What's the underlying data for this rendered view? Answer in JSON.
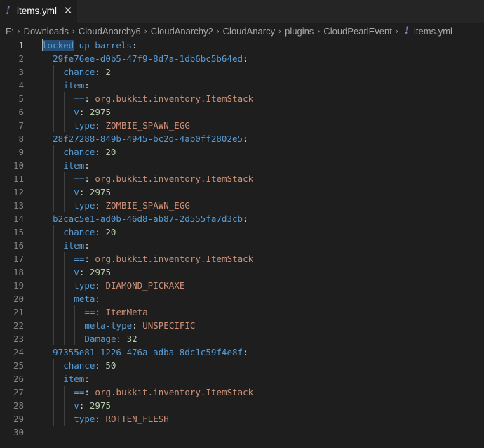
{
  "tab": {
    "icon": "!",
    "title": "items.yml",
    "close": "✕"
  },
  "breadcrumbs": {
    "items": [
      "F:",
      "Downloads",
      "CloudAnarchy6",
      "CloudAnarchy2",
      "CloudAnarcy",
      "plugins",
      "CloudPearlEvent"
    ],
    "separator": "›",
    "file_icon": "!",
    "file": "items.yml"
  },
  "editor": {
    "active_line": 1,
    "lines": [
      {
        "num": "1",
        "indent": 0,
        "key": "locked-up-barrels",
        "sep": ":",
        "value": "",
        "vtype": "",
        "highlight": "locked"
      },
      {
        "num": "2",
        "indent": 1,
        "key": "29fe76ee-d0b5-47f9-8d7a-1db6bc5b64ed",
        "sep": ":",
        "value": "",
        "vtype": ""
      },
      {
        "num": "3",
        "indent": 2,
        "key": "chance",
        "sep": ": ",
        "value": "2",
        "vtype": "n"
      },
      {
        "num": "4",
        "indent": 2,
        "key": "item",
        "sep": ":",
        "value": "",
        "vtype": ""
      },
      {
        "num": "5",
        "indent": 3,
        "key": "==",
        "sep": ": ",
        "value": "org.bukkit.inventory.ItemStack",
        "vtype": "s"
      },
      {
        "num": "6",
        "indent": 3,
        "key": "v",
        "sep": ": ",
        "value": "2975",
        "vtype": "n"
      },
      {
        "num": "7",
        "indent": 3,
        "key": "type",
        "sep": ": ",
        "value": "ZOMBIE_SPAWN_EGG",
        "vtype": "s"
      },
      {
        "num": "8",
        "indent": 1,
        "key": "28f27288-849b-4945-bc2d-4ab0ff2802e5",
        "sep": ":",
        "value": "",
        "vtype": ""
      },
      {
        "num": "9",
        "indent": 2,
        "key": "chance",
        "sep": ": ",
        "value": "20",
        "vtype": "n"
      },
      {
        "num": "10",
        "indent": 2,
        "key": "item",
        "sep": ":",
        "value": "",
        "vtype": ""
      },
      {
        "num": "11",
        "indent": 3,
        "key": "==",
        "sep": ": ",
        "value": "org.bukkit.inventory.ItemStack",
        "vtype": "s"
      },
      {
        "num": "12",
        "indent": 3,
        "key": "v",
        "sep": ": ",
        "value": "2975",
        "vtype": "n"
      },
      {
        "num": "13",
        "indent": 3,
        "key": "type",
        "sep": ": ",
        "value": "ZOMBIE_SPAWN_EGG",
        "vtype": "s"
      },
      {
        "num": "14",
        "indent": 1,
        "key": "b2cac5e1-ad0b-46d8-ab87-2d555fa7d3cb",
        "sep": ":",
        "value": "",
        "vtype": ""
      },
      {
        "num": "15",
        "indent": 2,
        "key": "chance",
        "sep": ": ",
        "value": "20",
        "vtype": "n"
      },
      {
        "num": "16",
        "indent": 2,
        "key": "item",
        "sep": ":",
        "value": "",
        "vtype": ""
      },
      {
        "num": "17",
        "indent": 3,
        "key": "==",
        "sep": ": ",
        "value": "org.bukkit.inventory.ItemStack",
        "vtype": "s"
      },
      {
        "num": "18",
        "indent": 3,
        "key": "v",
        "sep": ": ",
        "value": "2975",
        "vtype": "n"
      },
      {
        "num": "19",
        "indent": 3,
        "key": "type",
        "sep": ": ",
        "value": "DIAMOND_PICKAXE",
        "vtype": "s"
      },
      {
        "num": "20",
        "indent": 3,
        "key": "meta",
        "sep": ":",
        "value": "",
        "vtype": ""
      },
      {
        "num": "21",
        "indent": 4,
        "key": "==",
        "sep": ": ",
        "value": "ItemMeta",
        "vtype": "s"
      },
      {
        "num": "22",
        "indent": 4,
        "key": "meta-type",
        "sep": ": ",
        "value": "UNSPECIFIC",
        "vtype": "s"
      },
      {
        "num": "23",
        "indent": 4,
        "key": "Damage",
        "sep": ": ",
        "value": "32",
        "vtype": "n"
      },
      {
        "num": "24",
        "indent": 1,
        "key": "97355e81-1226-476a-adba-8dc1c59f4e8f",
        "sep": ":",
        "value": "",
        "vtype": ""
      },
      {
        "num": "25",
        "indent": 2,
        "key": "chance",
        "sep": ": ",
        "value": "50",
        "vtype": "n"
      },
      {
        "num": "26",
        "indent": 2,
        "key": "item",
        "sep": ":",
        "value": "",
        "vtype": ""
      },
      {
        "num": "27",
        "indent": 3,
        "key": "==",
        "sep": ": ",
        "value": "org.bukkit.inventory.ItemStack",
        "vtype": "s"
      },
      {
        "num": "28",
        "indent": 3,
        "key": "v",
        "sep": ": ",
        "value": "2975",
        "vtype": "n"
      },
      {
        "num": "29",
        "indent": 3,
        "key": "type",
        "sep": ": ",
        "value": "ROTTEN_FLESH",
        "vtype": "s"
      },
      {
        "num": "30",
        "indent": 0,
        "key": "",
        "sep": "",
        "value": "",
        "vtype": ""
      }
    ]
  }
}
